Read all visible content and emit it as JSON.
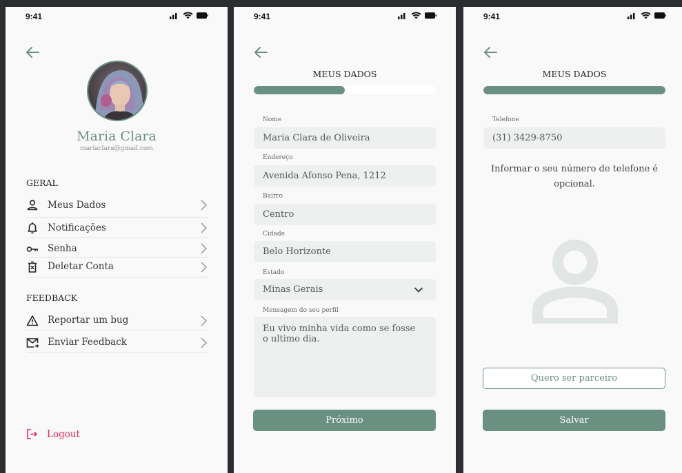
{
  "status_bar": {
    "time": "9:41"
  },
  "profile": {
    "name": "Maria Clara",
    "email": "mariaclara@gmail.com",
    "general_title": "GERAL",
    "general_items": [
      {
        "label": "Meus Dados",
        "icon": "user-icon"
      },
      {
        "label": "Notificações",
        "icon": "bell-icon"
      },
      {
        "label": "Senha",
        "icon": "key-icon"
      },
      {
        "label": "Deletar Conta",
        "icon": "trash-icon"
      }
    ],
    "feedback_title": "FEEDBACK",
    "feedback_items": [
      {
        "label": "Reportar um bug",
        "icon": "warning-icon"
      },
      {
        "label": "Enviar Feedback",
        "icon": "mail-send-icon"
      }
    ],
    "logout_label": "Logout"
  },
  "form": {
    "title": "MEUS DADOS",
    "progress": 0.5,
    "fields": {
      "nome": {
        "label": "Nome",
        "value": "Maria Clara de Oliveira"
      },
      "endereco": {
        "label": "Endereço",
        "value": "Avenida Afonso Pena, 1212"
      },
      "bairro": {
        "label": "Bairro",
        "value": "Centro"
      },
      "cidade": {
        "label": "Cidade",
        "value": "Belo Horizonte"
      },
      "estado": {
        "label": "Estado",
        "value": "Minas Gerais"
      },
      "mensagem": {
        "label": "Mensagem do seu perfil",
        "value": "Eu vivo minha vida como se fosse\no ultimo dia."
      }
    },
    "next_label": "Próximo"
  },
  "phone": {
    "title": "MEUS DADOS",
    "progress": 1.0,
    "label": "Telefone",
    "value": "(31) 3429-8750",
    "note": "Informar o seu número de telefone é opcional.",
    "partner_label": "Quero ser parceiro",
    "save_label": "Salvar"
  },
  "colors": {
    "accent": "#6a9082",
    "logout": "#e6285a",
    "field_bg": "#eef0f0"
  }
}
